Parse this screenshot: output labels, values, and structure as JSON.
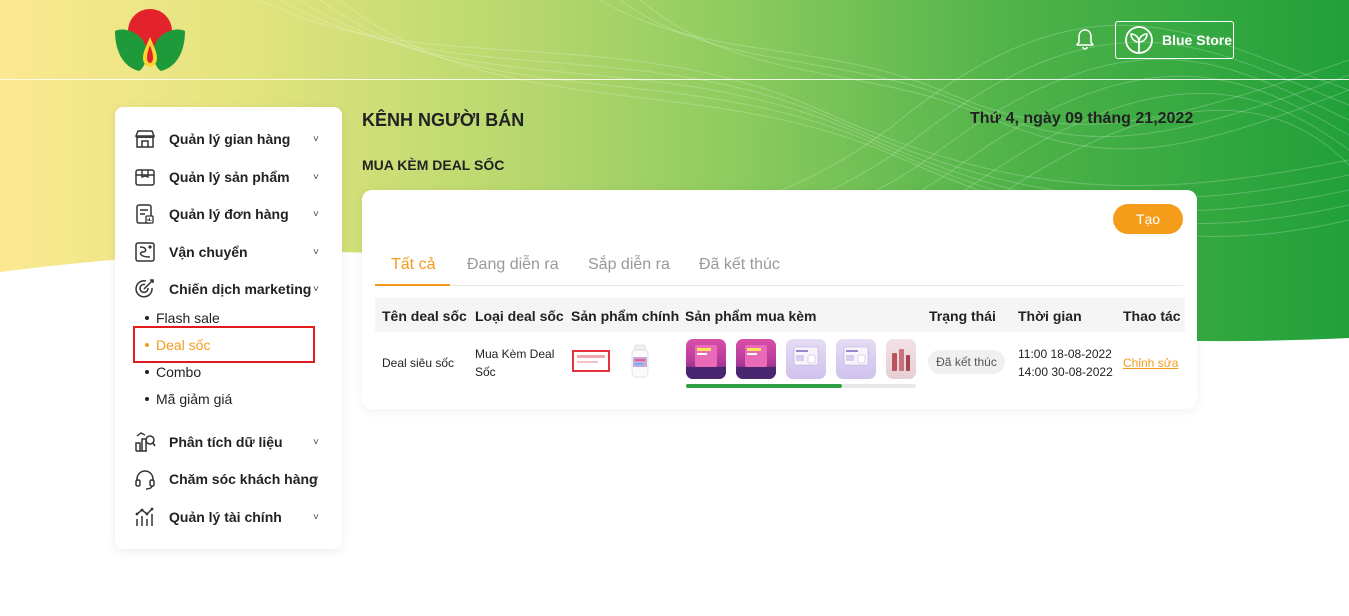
{
  "header": {
    "store_name": "Blue Store",
    "notification_icon": "bell-icon",
    "logo_icon": "leaf-drop-logo"
  },
  "colors": {
    "accent": "#f29b1c",
    "brand_green": "#21a03a",
    "highlight_red": "#e01b1b"
  },
  "sidebar": {
    "items": [
      {
        "label": "Quản lý gian hàng",
        "icon": "store-icon"
      },
      {
        "label": "Quản lý sản phẩm",
        "icon": "box-icon"
      },
      {
        "label": "Quản lý đơn hàng",
        "icon": "clipboard-icon"
      },
      {
        "label": "Vận chuyển",
        "icon": "route-icon"
      },
      {
        "label": "Chiến dịch marketing",
        "icon": "target-icon"
      },
      {
        "label": "Phân tích dữ liệu",
        "icon": "analytics-icon"
      },
      {
        "label": "Chăm sóc khách hàng",
        "icon": "headset-icon"
      },
      {
        "label": "Quản lý tài chính",
        "icon": "finance-icon"
      }
    ],
    "marketing_sub": [
      {
        "label": "Flash sale"
      },
      {
        "label": "Deal sốc"
      },
      {
        "label": "Combo"
      },
      {
        "label": "Mã giảm giá"
      }
    ],
    "chevron": "˅"
  },
  "main": {
    "title": "KÊNH NGƯỜI BÁN",
    "date": "Thứ 4, ngày 09 tháng 21,2022",
    "section_title": "MUA KÈM DEAL SỐC",
    "create_label": "Tạo",
    "tabs": [
      {
        "label": "Tất cả"
      },
      {
        "label": "Đang diễn ra"
      },
      {
        "label": "Sắp diễn ra"
      },
      {
        "label": "Đã kết thúc"
      }
    ],
    "columns": [
      "Tên deal sốc",
      "Loại deal sốc",
      "Sản phẩm chính",
      "Sản phẩm mua kèm",
      "Trạng thái",
      "Thời gian",
      "Thao tác"
    ],
    "row": {
      "name": "Deal siêu sốc",
      "type_line1": "Mua Kèm Deal",
      "type_line2": "Sốc",
      "status": "Đã kết thúc",
      "time_start": "11:00 18-08-2022",
      "time_end": "14:00 30-08-2022",
      "action": "Chỉnh sửa"
    }
  }
}
